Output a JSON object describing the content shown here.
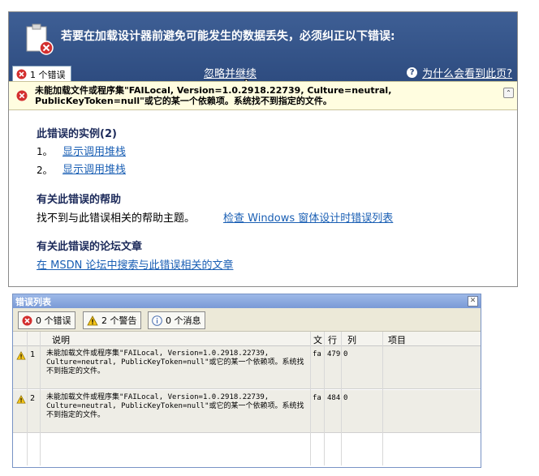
{
  "designer": {
    "banner_title": "若要在加载设计器前避免可能发生的数据丢失，必须纠正以下错误:",
    "error_tab_label": "1 个错误",
    "ignore_link": "忽略并继续",
    "why_link": "为什么会看到此页?",
    "error_message": "未能加载文件或程序集\"FAILocal, Version=1.0.2918.22739, Culture=neutral, PublicKeyToken=null\"或它的某一个依赖项。系统找不到指定的文件。",
    "instances": {
      "heading": "此错误的实例(2)",
      "items": [
        {
          "num": "1。",
          "link": "显示调用堆栈"
        },
        {
          "num": "2。",
          "link": "显示调用堆栈"
        }
      ]
    },
    "help": {
      "heading": "有关此错误的帮助",
      "text": "找不到与此错误相关的帮助主题。",
      "link": "检查 Windows 窗体设计时错误列表"
    },
    "forum": {
      "heading": "有关此错误的论坛文章",
      "link": "在 MSDN 论坛中搜索与此错误相关的文章"
    }
  },
  "error_list": {
    "title": "错误列表",
    "toolbar": {
      "errors": "0 个错误",
      "warnings": "2 个警告",
      "messages": "0 个消息"
    },
    "columns": {
      "description": "说明",
      "file": "文",
      "line": "行",
      "column": "列",
      "project": "项目"
    },
    "rows": [
      {
        "num": "1",
        "description": "未能加载文件或程序集\"FAILocal, Version=1.0.2918.22739, Culture=neutral, PublicKeyToken=null\"或它的某一个依赖项。系统找不到指定的文件。",
        "file": "fa",
        "line": "479",
        "column": "0"
      },
      {
        "num": "2",
        "description": "未能加载文件或程序集\"FAILocal, Version=1.0.2918.22739, Culture=neutral, PublicKeyToken=null\"或它的某一个依赖项。系统找不到指定的文件。",
        "file": "fa",
        "line": "484",
        "column": "0"
      }
    ]
  },
  "colors": {
    "banner": "#2e4c80",
    "link": "#1a5fb4",
    "error_red": "#d32f2f",
    "warning_yellow": "#f5c518"
  }
}
